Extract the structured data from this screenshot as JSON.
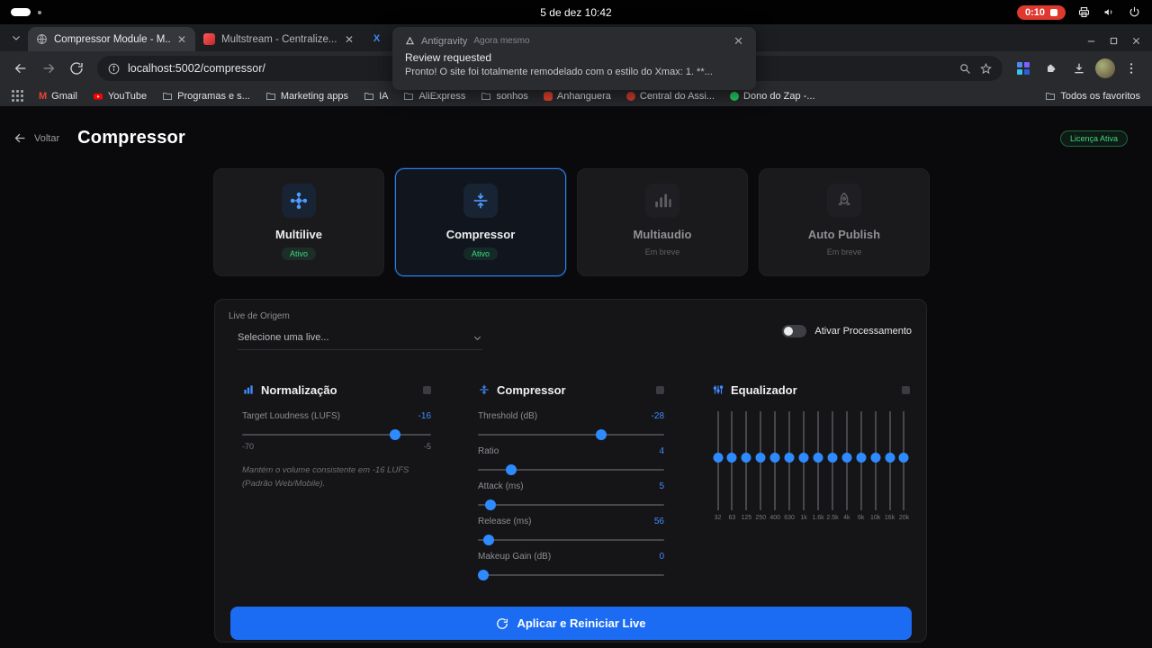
{
  "colors": {
    "accent_blue": "#2e8bff",
    "button_blue": "#1b6cf2",
    "active_green": "#3fd97f",
    "record_red": "#df382e"
  },
  "system_bar": {
    "clock": "5 de dez 10:42",
    "recording_badge": "0:10"
  },
  "browser": {
    "tabs": [
      {
        "title": "Compressor Module - M...",
        "state": "active"
      },
      {
        "title": "Multstream - Centralize...",
        "state": "inactive"
      },
      {
        "title": "",
        "favicon": "X",
        "state": "inactive"
      }
    ],
    "url": "localhost:5002/compressor/",
    "bookmarks": [
      "Gmail",
      "YouTube",
      "Programas e s...",
      "Marketing apps",
      "IA",
      "AliExpress",
      "sonhos",
      "Anhanguera",
      "Central do Assi...",
      "Dono do Zap -...",
      "Todos os favoritos"
    ]
  },
  "notification": {
    "app": "Antigravity",
    "time": "Agora mesmo",
    "title": "Review requested",
    "body": "Pronto! O site foi totalmente remodelado com o estilo do Xmax:  1. **..."
  },
  "page": {
    "header": {
      "back": "Voltar",
      "title": "Compressor",
      "license": "Licença Ativa"
    },
    "modules": [
      {
        "name": "Multilive",
        "status": "Ativo"
      },
      {
        "name": "Compressor",
        "status": "Ativo"
      },
      {
        "name": "Multiaudio",
        "status": "Em breve"
      },
      {
        "name": "Auto Publish",
        "status": "Em breve"
      }
    ],
    "source": {
      "label": "Live de Origem",
      "placeholder": "Selecione uma live...",
      "toggle_label": "Ativar Processamento"
    },
    "normalization": {
      "title": "Normalização",
      "param": "Target Loudness (LUFS)",
      "value": "-16",
      "min": "-70",
      "max": "-5",
      "percent": 81,
      "description": "Mantém o volume consistente em -16 LUFS (Padrão Web/Mobile)."
    },
    "compressor": {
      "title": "Compressor",
      "params": [
        {
          "label": "Threshold (dB)",
          "value": "-28",
          "percent": 66
        },
        {
          "label": "Ratio",
          "value": "4",
          "percent": 18
        },
        {
          "label": "Attack (ms)",
          "value": "5",
          "percent": 7
        },
        {
          "label": "Release (ms)",
          "value": "56",
          "percent": 6
        },
        {
          "label": "Makeup Gain (dB)",
          "value": "0",
          "percent": 3
        }
      ]
    },
    "equalizer": {
      "title": "Equalizador",
      "knob_percent": 46,
      "bands": [
        "32",
        "63",
        "125",
        "250",
        "400",
        "630",
        "1k",
        "1.6k",
        "2.5k",
        "4k",
        "6k",
        "10k",
        "16k",
        "20k"
      ]
    },
    "apply_button": "Aplicar e Reiniciar Live"
  }
}
